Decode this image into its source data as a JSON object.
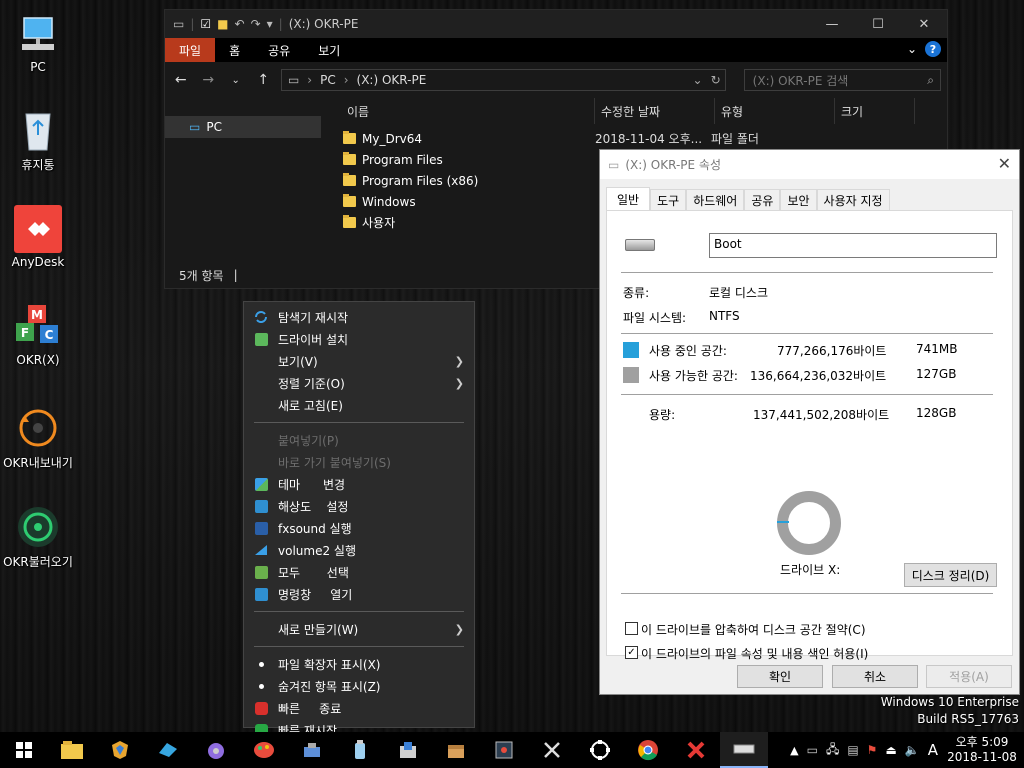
{
  "desktop": {
    "icons": [
      {
        "label": "PC",
        "icon": "monitor-icon"
      },
      {
        "label": "휴지통",
        "icon": "recycle-bin-icon"
      },
      {
        "label": "AnyDesk",
        "icon": "anydesk-icon"
      },
      {
        "label": "OKR(X)",
        "icon": "okr-icon"
      },
      {
        "label": "OKR내보내기",
        "icon": "export-icon"
      },
      {
        "label": "OKR불러오기",
        "icon": "import-icon"
      }
    ]
  },
  "explorer": {
    "title": "(X:) OKR-PE",
    "ribbon_tabs": [
      "파일",
      "홈",
      "공유",
      "보기"
    ],
    "address": {
      "segments": [
        "PC",
        "(X:) OKR-PE"
      ]
    },
    "search_placeholder": "(X:) OKR-PE 검색",
    "nav_selected": "PC",
    "columns": [
      "이름",
      "수정한 날짜",
      "유형",
      "크기"
    ],
    "files": [
      {
        "name": "My_Drv64",
        "date": "2018-11-04 오후...",
        "type": "파일 폴더"
      },
      {
        "name": "Program Files",
        "date": "",
        "type": ""
      },
      {
        "name": "Program Files (x86)",
        "date": "",
        "type": ""
      },
      {
        "name": "Windows",
        "date": "",
        "type": ""
      },
      {
        "name": "사용자",
        "date": "",
        "type": ""
      }
    ],
    "status": "5개 항목",
    "status_sep": "|"
  },
  "properties": {
    "title": "(X:) OKR-PE 속성",
    "tabs": [
      "일반",
      "도구",
      "하드웨어",
      "공유",
      "보안",
      "사용자 지정"
    ],
    "name_value": "Boot",
    "type_label": "종류:",
    "type_value": "로컬 디스크",
    "fs_label": "파일 시스템:",
    "fs_value": "NTFS",
    "used_label": "사용 중인 공간:",
    "used_bytes": "777,266,176바이트",
    "used_size": "741MB",
    "free_label": "사용 가능한 공간:",
    "free_bytes": "136,664,236,032바이트",
    "free_size": "127GB",
    "cap_label": "용량:",
    "cap_bytes": "137,441,502,208바이트",
    "cap_size": "128GB",
    "drive_label": "드라이브 X:",
    "cleanup_button": "디스크 정리(D)",
    "compress_label": "이 드라이브를 압축하여 디스크 공간 절약(C)",
    "index_label": "이 드라이브의 파일 속성 및 내용 색인 허용(I)",
    "ok": "확인",
    "cancel": "취소",
    "apply": "적용(A)",
    "colors": {
      "used": "#26a0da",
      "free": "#a0a0a0"
    }
  },
  "context_menu": {
    "items": [
      {
        "label": "탐색기 재시작",
        "icon": "refresh-icon",
        "disabled": false
      },
      {
        "label": "드라이버 설치",
        "icon": "driver-icon",
        "disabled": false
      },
      {
        "label": "보기(V)",
        "submenu": true
      },
      {
        "label": "정렬 기준(O)",
        "submenu": true
      },
      {
        "label": "새로 고침(E)"
      },
      {
        "label": "붙여넣기(P)",
        "disabled": true
      },
      {
        "label": "바로 가기 붙여넣기(S)",
        "disabled": true
      },
      {
        "label": "테마      변경",
        "icon": "theme-icon"
      },
      {
        "label": "해상도    설정",
        "icon": "display-icon"
      },
      {
        "label": "fxsound 실행",
        "icon": "fxsound-icon"
      },
      {
        "label": "volume2 실행",
        "icon": "volume-icon"
      },
      {
        "label": "모두       선택",
        "icon": "select-all-icon"
      },
      {
        "label": "명령창     열기",
        "icon": "cmd-icon"
      },
      {
        "label": "새로 만들기(W)",
        "submenu": true
      },
      {
        "label": "파일 확장자 표시(X)",
        "icon": "bullet-icon"
      },
      {
        "label": "숨겨진 항목 표시(Z)",
        "icon": "bullet-icon"
      },
      {
        "label": "빠른     종료",
        "icon": "power-icon"
      },
      {
        "label": "빠른 재시작",
        "icon": "restart-icon"
      }
    ]
  },
  "watermark": {
    "line1": "Windows 10 Enterprise",
    "line2": "Build   RS5_17763"
  },
  "tray": {
    "ime": "A",
    "time": "오후 5:09",
    "date": "2018-11-08"
  }
}
